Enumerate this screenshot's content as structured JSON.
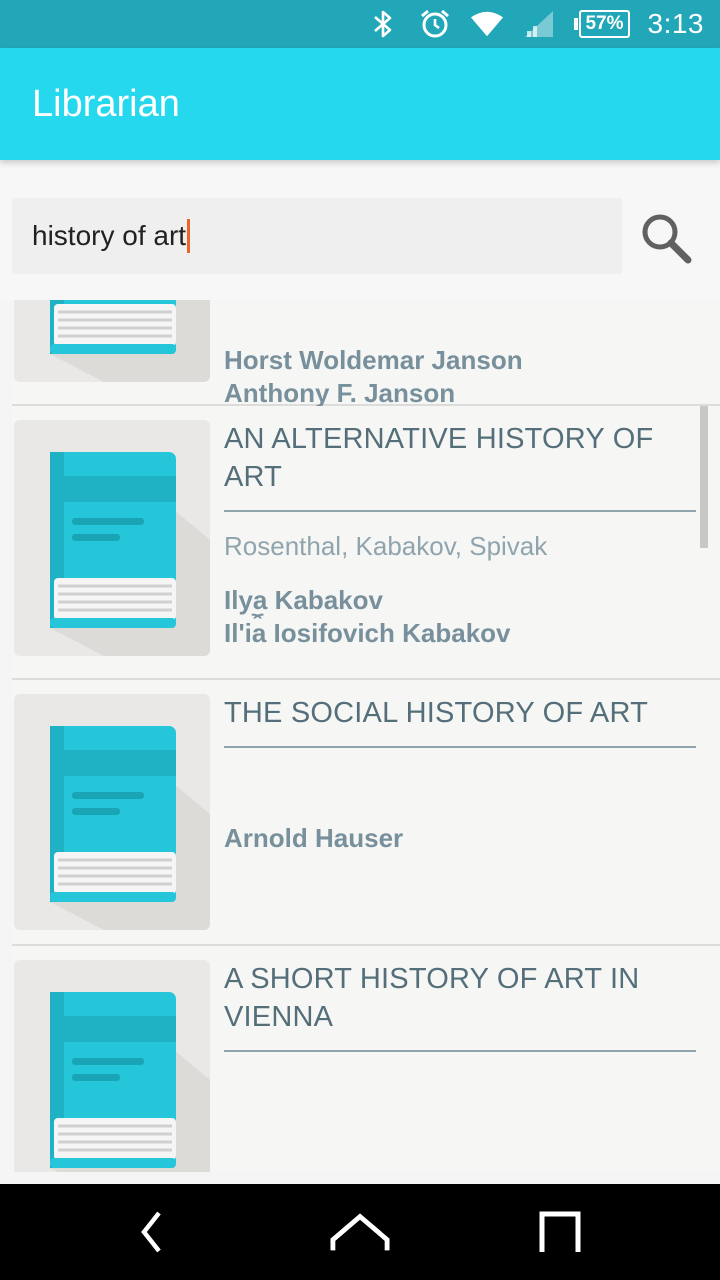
{
  "status_bar": {
    "battery": "57%",
    "time": "3:13"
  },
  "app_bar": {
    "title": "Librarian"
  },
  "search": {
    "value": "history of art"
  },
  "books": [
    {
      "title": "",
      "subtitle": "",
      "authors": [
        "Horst Woldemar Janson",
        "Anthony F. Janson"
      ]
    },
    {
      "title": "AN ALTERNATIVE HISTORY OF ART",
      "subtitle": "Rosenthal, Kabakov, Spivak",
      "authors": [
        "Ilya Kabakov",
        "Ilʹi︠a︡ Iosifovich Kabakov"
      ]
    },
    {
      "title": "THE SOCIAL HISTORY OF ART",
      "subtitle": "",
      "authors": [
        "Arnold Hauser"
      ]
    },
    {
      "title": "A SHORT HISTORY OF ART IN VIENNA",
      "subtitle": "",
      "authors": []
    }
  ],
  "colors": {
    "status_bar": "#21a7b8",
    "app_bar": "#26d8ee",
    "caret": "#e8662c",
    "title_text": "#546e7a",
    "author_text": "#78909c"
  }
}
